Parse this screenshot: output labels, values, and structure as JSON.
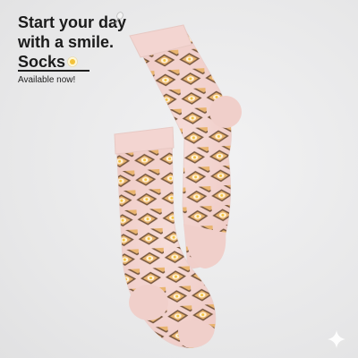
{
  "headline": {
    "line1": "Start your day",
    "line2": "with a smile.",
    "line3": "Socks"
  },
  "subtitle": "Available now!",
  "icons": {
    "top": "tennis-racket-icon",
    "inline": "fried-egg-icon",
    "corner": "sparkle-icon"
  },
  "colors": {
    "background": "#e9e9ea",
    "sock": "#f2d3cf",
    "pattern_outline": "#7a5a3a",
    "pattern_fill": "#e8b26a",
    "egg_yolk": "#f3c23a"
  }
}
